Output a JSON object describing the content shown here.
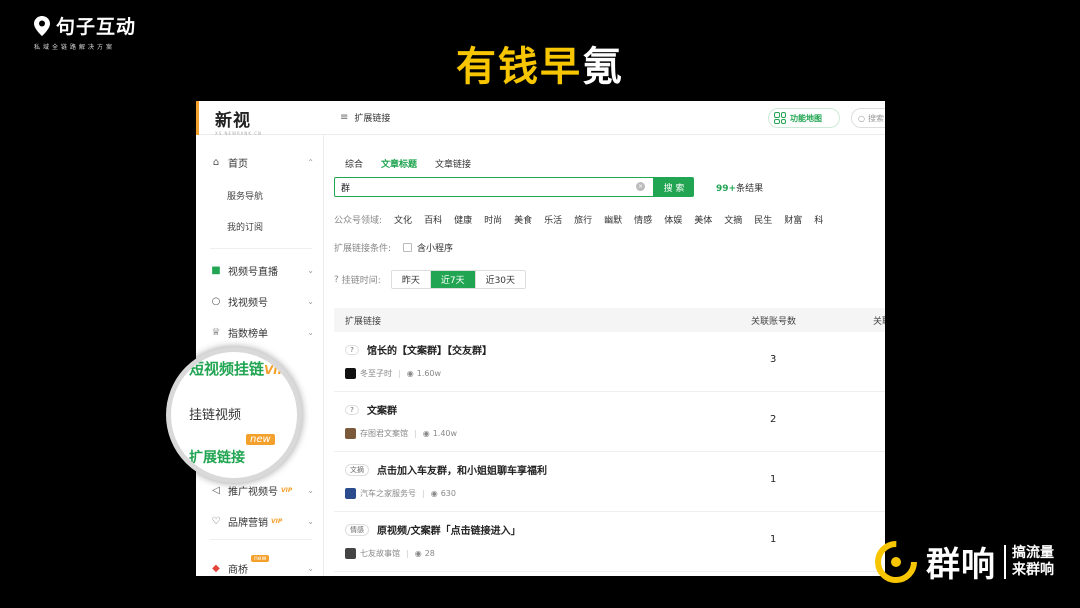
{
  "slide": {
    "brand_name": "句子互动",
    "brand_sub": "私域全链路解决方案",
    "title_highlight": "有钱早",
    "title_rest": "氪",
    "corner_name": "群响",
    "corner_slogan_1": "搞流量",
    "corner_slogan_2": "来群响"
  },
  "header": {
    "logo": "新视",
    "logo_sub": "XS.NEWRANK.CN",
    "breadcrumb": "扩展链接",
    "func_button": "功能地图",
    "search_placeholder": "搜索"
  },
  "sidebar": {
    "home": "首页",
    "service_nav": "服务导航",
    "my_subs": "我的订阅",
    "live": "视频号直播",
    "find": "找视频号",
    "rank": "指数榜单",
    "promote": "推广视频号",
    "brand": "品牌营销",
    "bridge": "商桥",
    "vip": "VIP",
    "new": "new"
  },
  "magnifier": {
    "short_video": "短视频挂链",
    "vip": "VIP",
    "hang_video": "挂链视频",
    "expand_link": "扩展链接",
    "new": "new"
  },
  "main": {
    "tabs": [
      {
        "label": "综合"
      },
      {
        "label": "文章标题"
      },
      {
        "label": "文章链接"
      }
    ],
    "search_value": "群",
    "search_button": "搜 索",
    "result_count": "99+",
    "result_suffix": "条结果",
    "domain_label": "公众号领域:",
    "domains": [
      "文化",
      "百科",
      "健康",
      "时尚",
      "美食",
      "乐活",
      "旅行",
      "幽默",
      "情感",
      "体娱",
      "美体",
      "文摘",
      "民生",
      "财富",
      "科"
    ],
    "cond_label": "扩展链接条件:",
    "cond_option": "含小程序",
    "time_label": "挂链时间:",
    "time_options": [
      "昨天",
      "近7天",
      "近30天"
    ],
    "table": {
      "col1": "扩展链接",
      "col2": "关联账号数",
      "col3": "关联",
      "rows": [
        {
          "tag": "?",
          "title": "馆长的【文案群】【交友群】",
          "account": "冬至子时",
          "views": "1.60w",
          "count": "3"
        },
        {
          "tag": "?",
          "title": "文案群",
          "account": "存图君文案馆",
          "views": "1.40w",
          "count": "2"
        },
        {
          "tag": "文摘",
          "title": "点击加入车友群，和小姐姐聊车享福利",
          "account": "汽车之家服务号",
          "views": "630",
          "count": "1"
        },
        {
          "tag": "情感",
          "title": "原视频/文案群「点击链接进入」",
          "account": "七友故事馆",
          "views": "28",
          "count": "1"
        }
      ]
    }
  },
  "colors": {
    "accent_green": "#22a552",
    "accent_orange": "#f3a12c",
    "title_yellow": "#f7c600"
  }
}
